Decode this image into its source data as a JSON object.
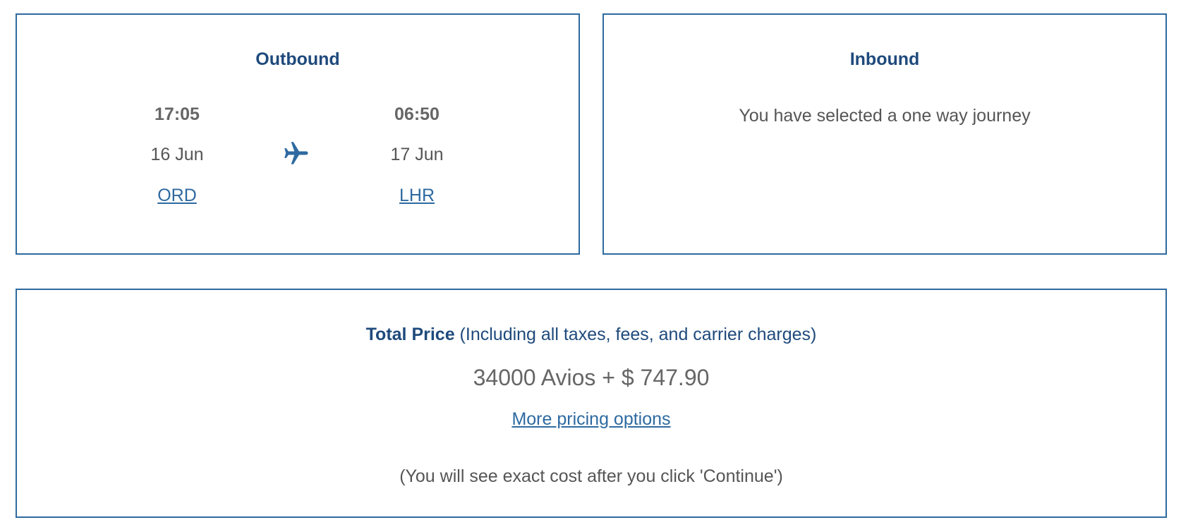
{
  "outbound": {
    "title": "Outbound",
    "depart": {
      "time": "17:05",
      "date": "16 Jun",
      "airport": "ORD"
    },
    "arrive": {
      "time": "06:50",
      "date": "17 Jun",
      "airport": "LHR"
    },
    "icon": "airplane-icon"
  },
  "inbound": {
    "title": "Inbound",
    "message": "You have selected a one way journey"
  },
  "price": {
    "label": "Total Price",
    "label_note": " (Including all taxes, fees, and carrier charges)",
    "amount": "34000 Avios + $ 747.90",
    "more_options": "More pricing options",
    "note": "(You will see exact cost after you click 'Continue')"
  },
  "colors": {
    "border": "#2e6aa0",
    "heading": "#1f4a7c",
    "link": "#2e6aa0",
    "text": "#666666"
  }
}
